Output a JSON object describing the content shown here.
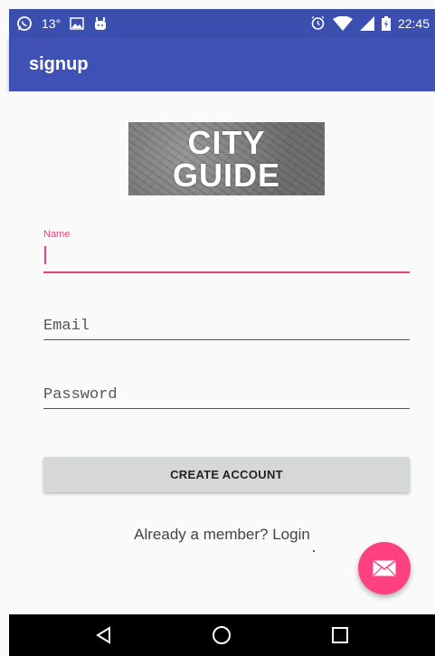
{
  "status_bar": {
    "temperature": "13°",
    "time": "22:45",
    "icons": [
      "whatsapp-icon",
      "image-icon",
      "android-icon",
      "alarm-icon",
      "wifi-icon",
      "signal-icon",
      "battery-icon"
    ]
  },
  "app_bar": {
    "title": "signup"
  },
  "logo": {
    "line1": "CITY",
    "line2": "GUIDE"
  },
  "form": {
    "name": {
      "label": "Name",
      "value": ""
    },
    "email": {
      "placeholder": "Email",
      "value": ""
    },
    "password": {
      "placeholder": "Password",
      "value": ""
    },
    "create_button": "CREATE ACCOUNT",
    "login_link": "Already a member? Login"
  },
  "fab": {
    "icon": "mail-icon"
  },
  "nav_bar": {
    "icons": [
      "back-icon",
      "home-icon",
      "recents-icon"
    ]
  },
  "colors": {
    "status_bar": "#3b4fae",
    "app_bar": "#3f51b5",
    "accent": "#ec407a",
    "fab": "#ff4081",
    "background": "#fafafa"
  }
}
